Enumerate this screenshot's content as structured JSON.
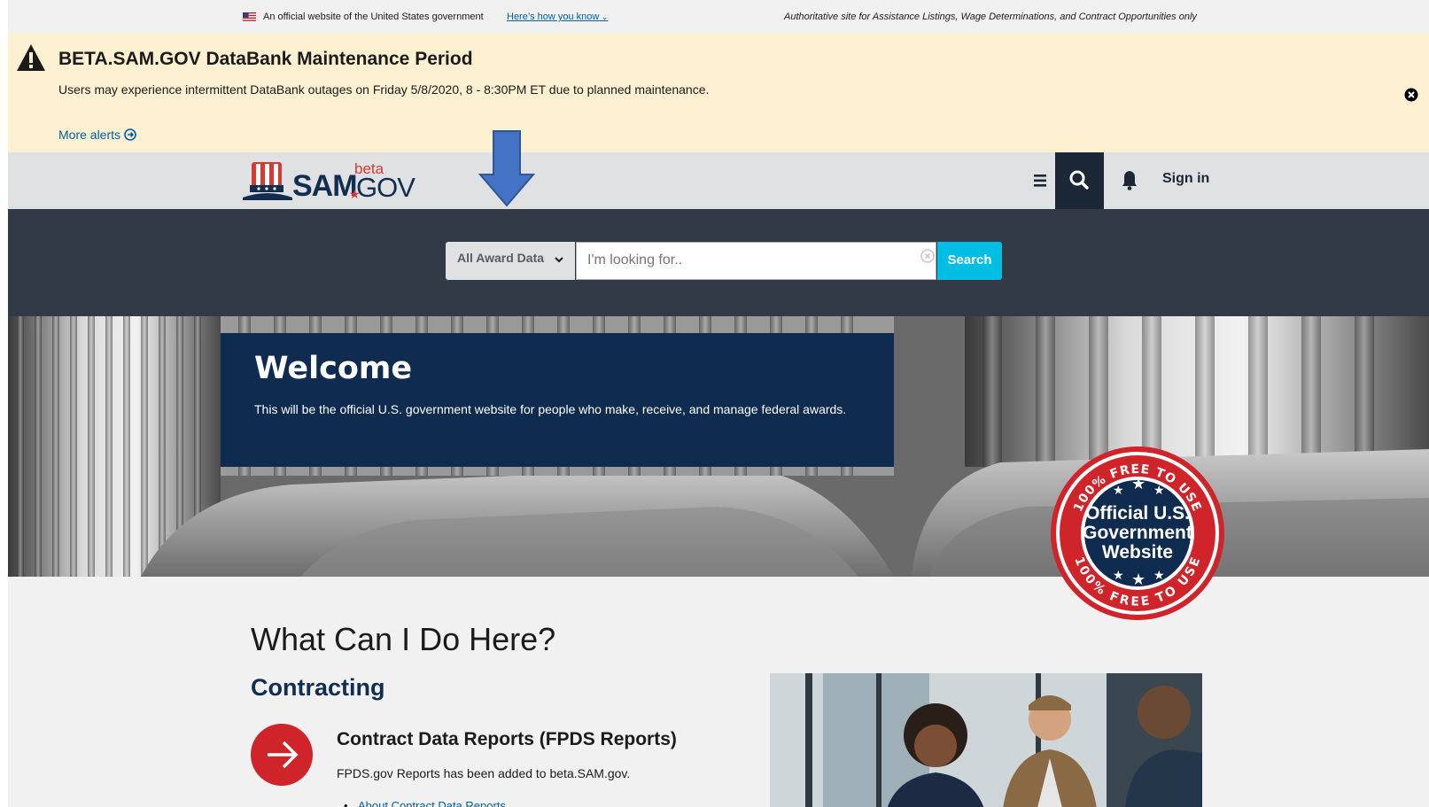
{
  "gov_banner": {
    "official_text": "An official website of the United States government",
    "how_you_know": "Here’s how you know",
    "authoritative": "Authoritative site for Assistance Listings, Wage Determinations, and Contract Opportunities only"
  },
  "alert": {
    "title": "BETA.SAM.GOV DataBank Maintenance Period",
    "message": "Users may experience  intermittent DataBank outages on Friday 5/8/2020, 8 - 8:30PM ET due to planned maintenance.",
    "more_alerts": "More alerts"
  },
  "header": {
    "logo_sam": "SAM",
    "logo_beta": "beta",
    "logo_gov": "GOV",
    "sign_in": "Sign in"
  },
  "search": {
    "domain_selected": "All Award Data",
    "placeholder": "I'm looking for..",
    "button": "Search"
  },
  "hero": {
    "welcome_title": "Welcome",
    "welcome_text": "This will be the official U.S. government website for people who make, receive, and manage federal awards."
  },
  "seal": {
    "ring_text": "100% FREE TO USE",
    "line1": "Official U.S.",
    "line2": "Government",
    "line3": "Website"
  },
  "content": {
    "heading": "What Can I Do Here?",
    "section_title": "Contracting",
    "item_title": "Contract Data Reports (FPDS Reports)",
    "item_desc": "FPDS.gov Reports has been added to beta.SAM.gov.",
    "item_link": "About Contract Data Reports"
  },
  "colors": {
    "alert_bg": "#fdf0d0",
    "header_bg": "#dfe1e2",
    "search_band": "#323a45",
    "search_button": "#00bde3",
    "welcome_bg": "#0f2b4f",
    "accent_red": "#d0242b"
  },
  "icons": [
    "flag-icon",
    "warning-icon",
    "arrow-circle-right-icon",
    "close-icon",
    "menu-icon",
    "search-icon",
    "bell-icon",
    "chevron-down-icon",
    "clear-icon",
    "arrow-right-icon"
  ]
}
